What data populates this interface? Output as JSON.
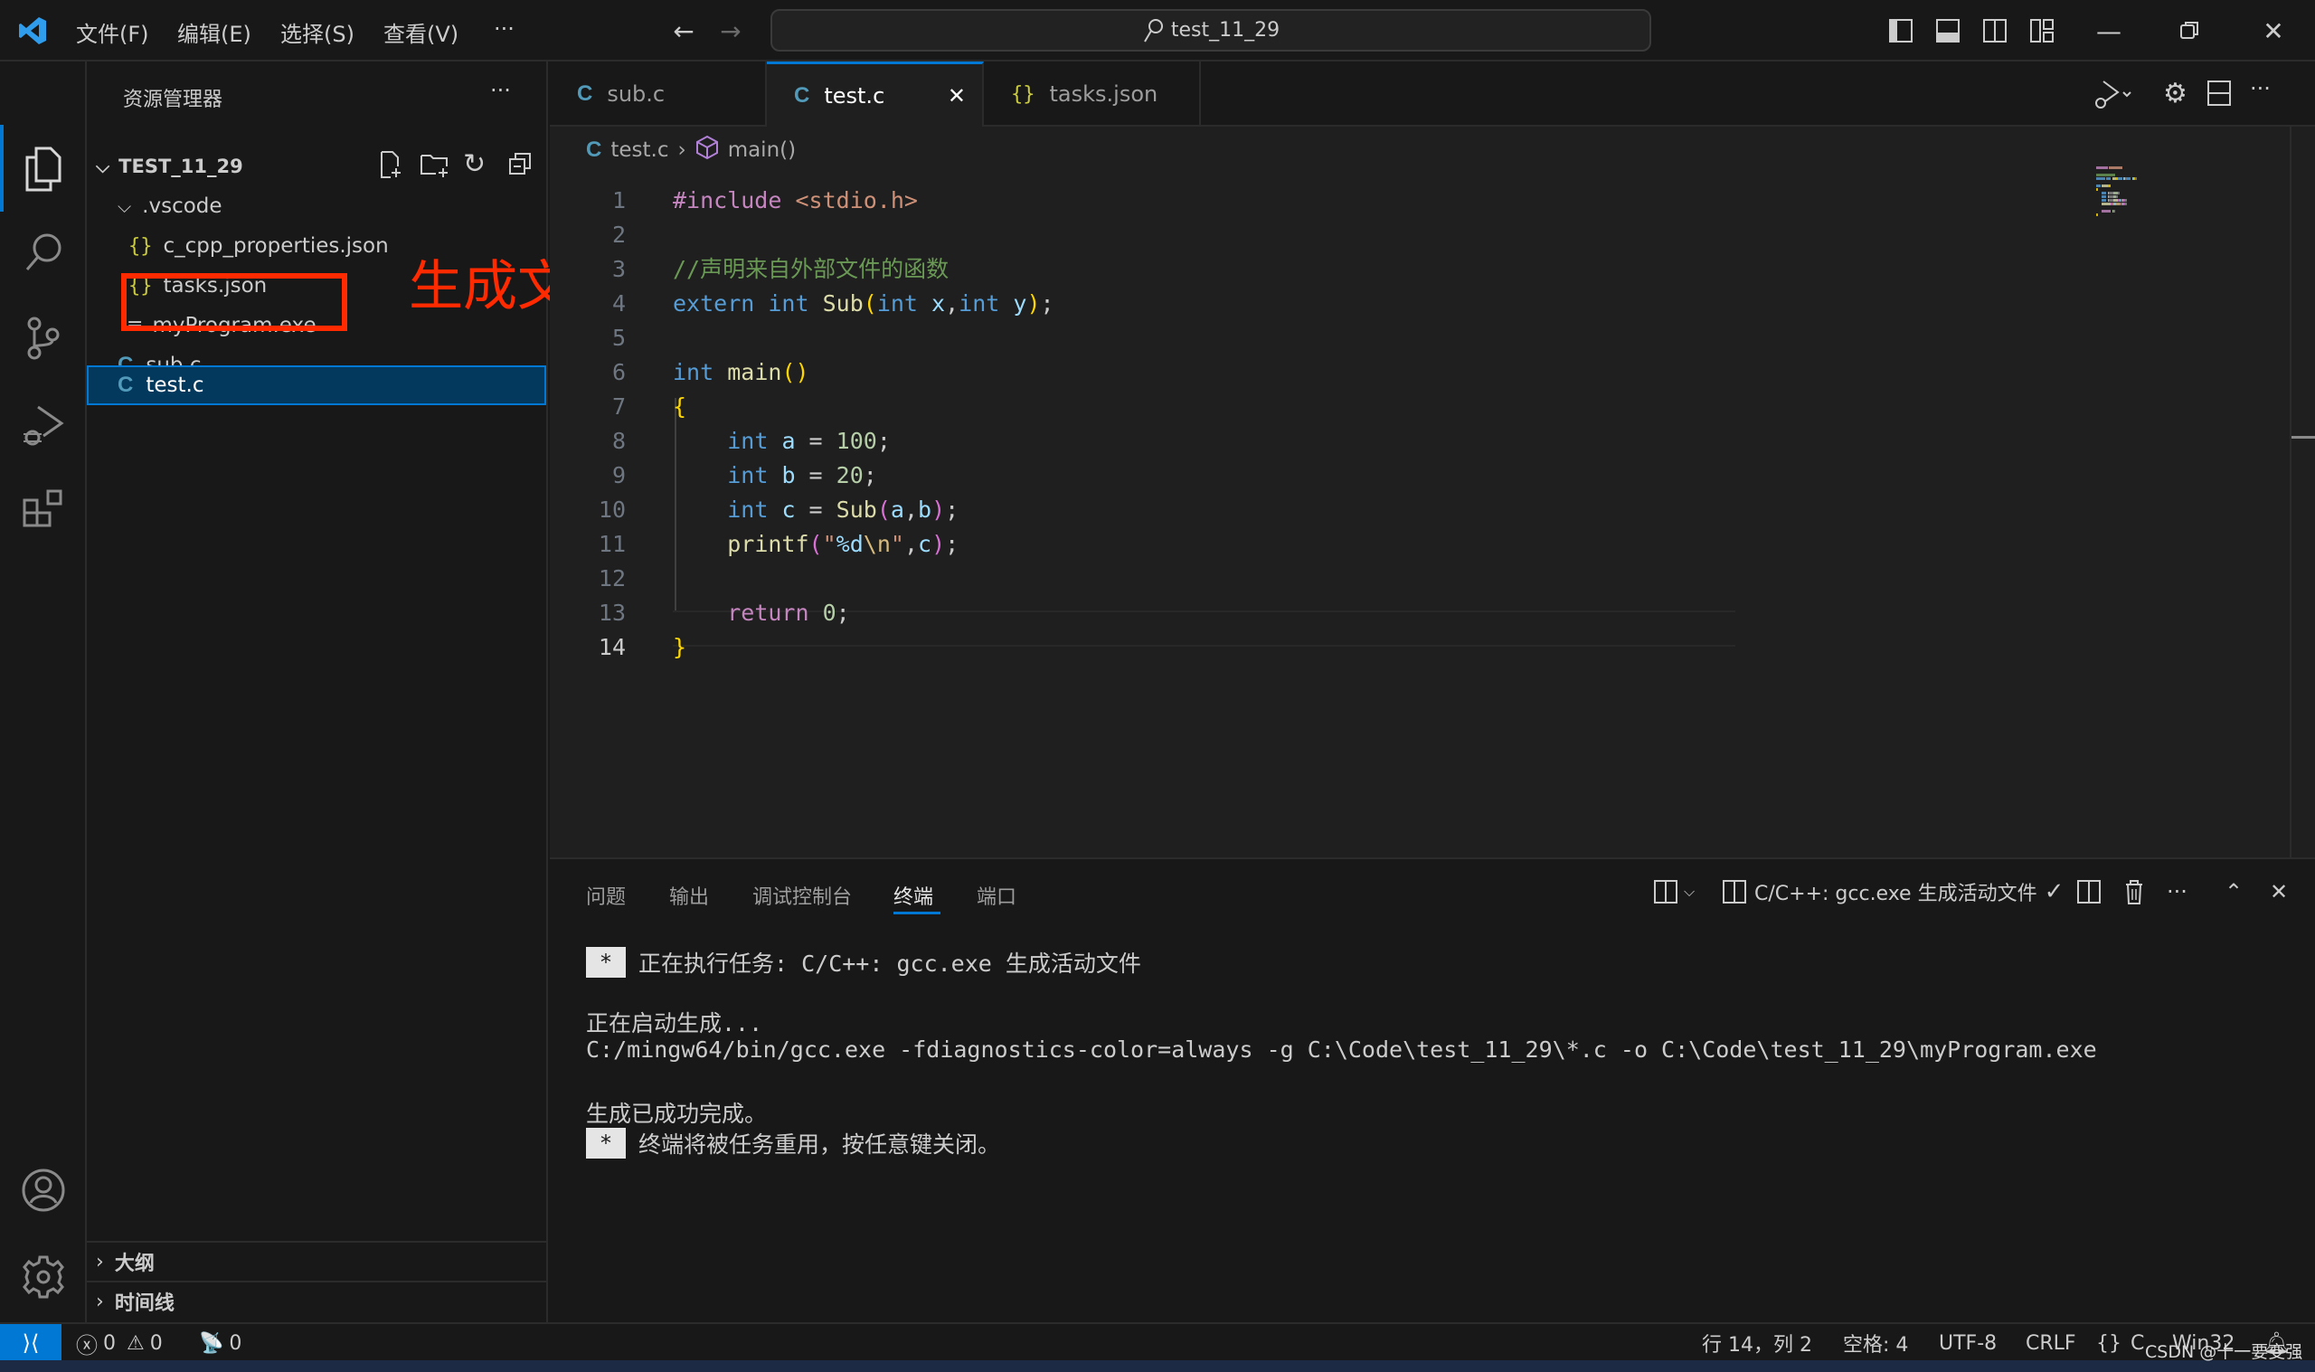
{
  "titlebar": {
    "menus": [
      "文件(F)",
      "编辑(E)",
      "选择(S)",
      "查看(V)",
      "···"
    ],
    "search_text": "test_11_29",
    "icons": [
      "vscode-logo-icon",
      "back-arrow-icon",
      "forward-arrow-icon",
      "toggle-sidebar-icon",
      "toggle-panel-icon",
      "toggle-secondary-sidebar-icon",
      "customize-layout-icon",
      "minimize-icon",
      "restore-icon",
      "close-icon"
    ]
  },
  "activitybar": {
    "top_items": [
      "explorer",
      "search",
      "source-control",
      "run-and-debug",
      "extensions"
    ],
    "bottom_items": [
      "accounts",
      "manage-settings"
    ]
  },
  "sidebar": {
    "title": "资源管理器",
    "more": "···",
    "root": "TEST_11_29",
    "tree": [
      {
        "label": ".vscode",
        "type": "folder",
        "expanded": true
      },
      {
        "label": "c_cpp_properties.json",
        "type": "json"
      },
      {
        "label": "tasks.json",
        "type": "json"
      },
      {
        "label": "myProgram.exe",
        "type": "exe"
      },
      {
        "label": "sub.c",
        "type": "c"
      },
      {
        "label": "test.c",
        "type": "c",
        "selected": true
      }
    ],
    "sections": [
      "大纲",
      "时间线"
    ]
  },
  "annotation": {
    "text": "生成文件",
    "color": "#ff2a00"
  },
  "tabs": [
    {
      "icon": "C",
      "label": "sub.c",
      "active": false
    },
    {
      "icon": "C",
      "label": "test.c",
      "active": true,
      "close": "✕"
    },
    {
      "icon": "{}",
      "label": "tasks.json",
      "active": false
    }
  ],
  "breadcrumb": {
    "file_icon": "C",
    "file": "test.c",
    "sep": "›",
    "symbol": "main()"
  },
  "editor": {
    "current_line": 14,
    "lines": [
      {
        "n": "1",
        "t": [
          [
            "ctl",
            "#include"
          ],
          [
            "pl",
            " "
          ],
          [
            "str",
            "<stdio.h>"
          ]
        ]
      },
      {
        "n": "2",
        "t": []
      },
      {
        "n": "3",
        "t": [
          [
            "cmt",
            "//声明来自外部文件的函数"
          ]
        ]
      },
      {
        "n": "4",
        "t": [
          [
            "kw",
            "extern"
          ],
          [
            "pl",
            " "
          ],
          [
            "kw",
            "int"
          ],
          [
            "pl",
            " "
          ],
          [
            "fn",
            "Sub"
          ],
          [
            "p1",
            "("
          ],
          [
            "kw",
            "int"
          ],
          [
            "pl",
            " "
          ],
          [
            "var",
            "x"
          ],
          [
            "pl",
            ","
          ],
          [
            "kw",
            "int"
          ],
          [
            "pl",
            " "
          ],
          [
            "var",
            "y"
          ],
          [
            "p1",
            ")"
          ],
          [
            "pl",
            ";"
          ]
        ]
      },
      {
        "n": "5",
        "t": []
      },
      {
        "n": "6",
        "t": [
          [
            "kw",
            "int"
          ],
          [
            "pl",
            " "
          ],
          [
            "fn",
            "main"
          ],
          [
            "p1",
            "()"
          ]
        ]
      },
      {
        "n": "7",
        "t": [
          [
            "p1",
            "{"
          ]
        ]
      },
      {
        "n": "8",
        "t": [
          [
            "pl",
            "    "
          ],
          [
            "kw",
            "int"
          ],
          [
            "pl",
            " "
          ],
          [
            "var",
            "a"
          ],
          [
            "pl",
            " = "
          ],
          [
            "num",
            "100"
          ],
          [
            "pl",
            ";"
          ]
        ]
      },
      {
        "n": "9",
        "t": [
          [
            "pl",
            "    "
          ],
          [
            "kw",
            "int"
          ],
          [
            "pl",
            " "
          ],
          [
            "var",
            "b"
          ],
          [
            "pl",
            " = "
          ],
          [
            "num",
            "20"
          ],
          [
            "pl",
            ";"
          ]
        ]
      },
      {
        "n": "10",
        "t": [
          [
            "pl",
            "    "
          ],
          [
            "kw",
            "int"
          ],
          [
            "pl",
            " "
          ],
          [
            "var",
            "c"
          ],
          [
            "pl",
            " = "
          ],
          [
            "fn",
            "Sub"
          ],
          [
            "p2",
            "("
          ],
          [
            "var",
            "a"
          ],
          [
            "pl",
            ","
          ],
          [
            "var",
            "b"
          ],
          [
            "p2",
            ")"
          ],
          [
            "pl",
            ";"
          ]
        ]
      },
      {
        "n": "11",
        "t": [
          [
            "pl",
            "    "
          ],
          [
            "fn",
            "printf"
          ],
          [
            "p2",
            "("
          ],
          [
            "str",
            "\""
          ],
          [
            "var",
            "%d"
          ],
          [
            "esc",
            "\\n"
          ],
          [
            "str",
            "\""
          ],
          [
            "pl",
            ","
          ],
          [
            "var",
            "c"
          ],
          [
            "p2",
            ")"
          ],
          [
            "pl",
            ";"
          ]
        ]
      },
      {
        "n": "12",
        "t": []
      },
      {
        "n": "13",
        "t": [
          [
            "pl",
            "    "
          ],
          [
            "ctl",
            "return"
          ],
          [
            "pl",
            " "
          ],
          [
            "num",
            "0"
          ],
          [
            "pl",
            ";"
          ]
        ]
      },
      {
        "n": "14",
        "t": [
          [
            "p1",
            "}"
          ]
        ]
      }
    ]
  },
  "editor_actions": [
    "run-debug-icon",
    "settings-gear-icon",
    "split-editor-icon",
    "more-actions-icon"
  ],
  "panel": {
    "tabs": [
      "问题",
      "输出",
      "调试控制台",
      "终端",
      "端口"
    ],
    "active_tab": "终端",
    "terminal_name": "C/C++: gcc.exe 生成活动文件",
    "terminal_lines": [
      {
        "star": true,
        "text": "正在执行任务: C/C++: gcc.exe 生成活动文件"
      },
      {
        "star": false,
        "text": "正在启动生成..."
      },
      {
        "star": false,
        "text": "C:/mingw64/bin/gcc.exe -fdiagnostics-color=always -g C:\\Code\\test_11_29\\*.c -o C:\\Code\\test_11_29\\myProgram.exe"
      },
      {
        "star": false,
        "text": "生成已成功完成。"
      },
      {
        "star": true,
        "text": "终端将被任务重用，按任意键关闭。"
      }
    ],
    "star_glyph": "*"
  },
  "statusbar": {
    "remote": "⟩⟨",
    "errors": "0",
    "warnings": "0",
    "ports": "0",
    "position": "行 14，列 2",
    "spaces": "空格: 4",
    "encoding": "UTF-8",
    "eol": "CRLF",
    "language": "C",
    "platform": "Win32"
  },
  "watermark": "CSDN @十一要变强"
}
